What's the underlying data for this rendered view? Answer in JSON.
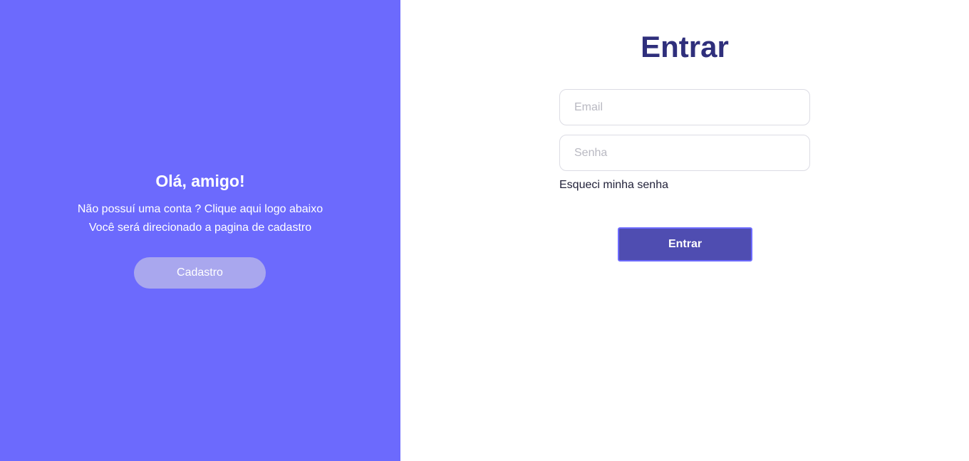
{
  "welcome": {
    "title": "Olá, amigo!",
    "line1": "Não possuí uma conta ? Clique aqui logo abaixo",
    "line2": "Você será direcionado a pagina de cadastro",
    "signup_label": "Cadastro"
  },
  "login": {
    "title": "Entrar",
    "email_placeholder": "Email",
    "email_value": "",
    "password_placeholder": "Senha",
    "password_value": "",
    "forgot_label": "Esqueci minha senha",
    "submit_label": "Entrar"
  },
  "colors": {
    "accent": "#6c6afd",
    "signup_button": "#a9a7ee",
    "title": "#2f2f7c",
    "submit_button": "#4f4db1"
  }
}
